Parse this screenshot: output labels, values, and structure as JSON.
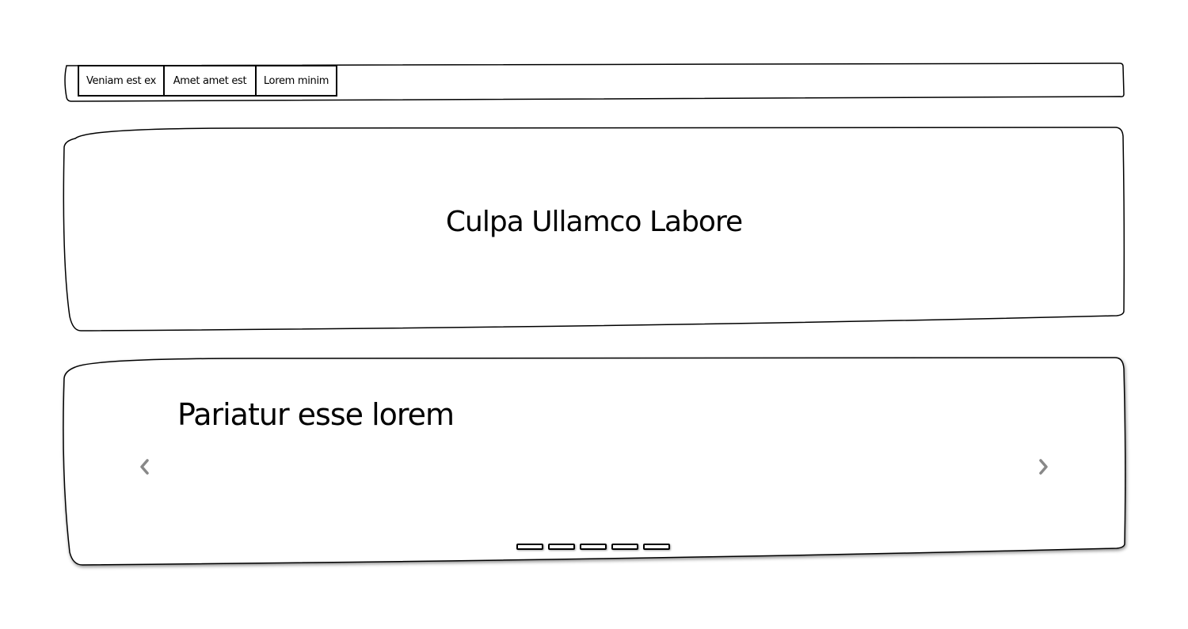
{
  "tabs": [
    {
      "label": "Veniam est ex"
    },
    {
      "label": "Amet amet est"
    },
    {
      "label": "Lorem minim"
    }
  ],
  "hero": {
    "title": "Culpa Ullamco Labore"
  },
  "carousel": {
    "slide_title": "Pariatur esse lorem",
    "prev_icon": "chevron-left-icon",
    "next_icon": "chevron-right-icon",
    "indicator_count": 5,
    "arrow_color": "#888888"
  }
}
